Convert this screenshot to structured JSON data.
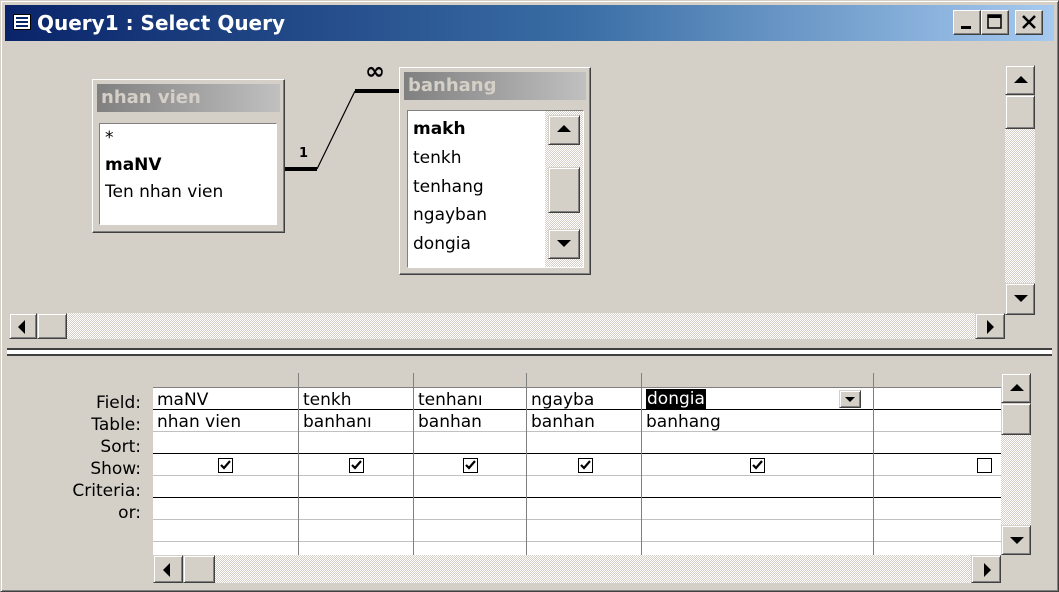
{
  "window": {
    "title": "Query1 : Select Query",
    "icon": "query-icon",
    "title_gradient": [
      "#0a246a",
      "#a6caf0"
    ]
  },
  "tables": [
    {
      "name": "nhan vien",
      "fields": [
        "*",
        "maNV",
        "Ten nhan vien"
      ],
      "bold_fields": [
        "maNV"
      ]
    },
    {
      "name": "banhang",
      "fields": [
        "makh",
        "tenkh",
        "tenhang",
        "ngayban",
        "dongia"
      ],
      "bold_fields": [
        "makh"
      ]
    }
  ],
  "relationship": {
    "one_label": "1",
    "many_label": "∞"
  },
  "grid": {
    "row_labels": [
      "Field:",
      "Table:",
      "Sort:",
      "Show:",
      "Criteria:",
      "or:"
    ],
    "columns": [
      {
        "field": "maNV",
        "table": "nhan vien",
        "show": true
      },
      {
        "field": "tenkh",
        "table": "banhanı",
        "show": true
      },
      {
        "field": "tenhanı",
        "table": "banhan",
        "show": true
      },
      {
        "field": "ngayba",
        "table": "banhan",
        "show": true
      },
      {
        "field": "dongia",
        "table": "banhang",
        "show": true,
        "selected": true
      },
      {
        "field": "",
        "table": "",
        "show": false
      }
    ]
  },
  "colors": {
    "face": "#d4d0c8",
    "selection": "#000000",
    "text": "#000000"
  }
}
